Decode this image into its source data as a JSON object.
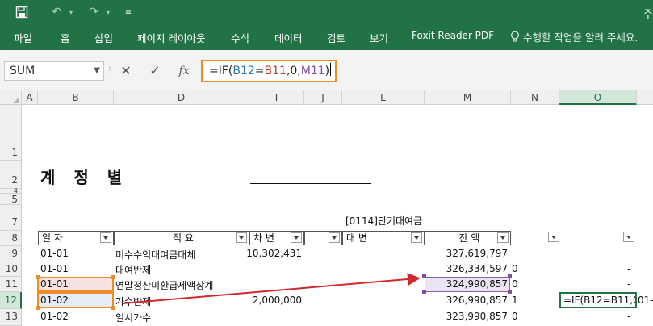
{
  "quick_access": {
    "save_icon": "save-icon",
    "undo_icon": "undo-icon",
    "redo_icon": "redo-icon",
    "customize_icon": "customize-icon"
  },
  "window": {
    "title_fragment": "주"
  },
  "ribbon": {
    "tabs": [
      "파일",
      "홈",
      "삽입",
      "페이지 레이아웃",
      "수식",
      "데이터",
      "검토",
      "보기",
      "Foxit Reader PDF"
    ],
    "tell_me": "수행할 작업을 알려 주세요."
  },
  "formula_bar": {
    "name_box": "SUM",
    "cancel_label": "✕",
    "enter_label": "✓",
    "fx_label": "fx",
    "formula_parts": [
      "=IF(",
      "B12",
      "=",
      "B11",
      ",0,",
      "M11",
      ")"
    ]
  },
  "columns": [
    "A",
    "B",
    "D",
    "I",
    "J",
    "L",
    "M",
    "N",
    "O"
  ],
  "rows": [
    "1",
    "2",
    "4",
    "5",
    "7",
    "8",
    "9",
    "10",
    "11",
    "12",
    "13"
  ],
  "sheet": {
    "title": "계 정 별",
    "subtitle": "[0114]단기대여금",
    "headers": {
      "date": "일  자",
      "desc": "적          요",
      "debit": "차  변",
      "credit": "대  변",
      "balance": "잔    액"
    },
    "data_rows": [
      {
        "date": "01-01",
        "desc": "미수수익대여금대체",
        "debit": "10,302,431",
        "balance": "327,619,797",
        "n": "",
        "o": ""
      },
      {
        "date": "01-01",
        "desc": "대여반제",
        "debit": "",
        "balance": "326,334,597",
        "n": "0",
        "o": "-"
      },
      {
        "date": "01-01",
        "desc": "연말정산미환급세액상계",
        "debit": "",
        "balance": "324,990,857",
        "n": "0",
        "o": "-"
      },
      {
        "date": "01-02",
        "desc": "가수반제",
        "debit": "2,000,000",
        "balance": "326,990,857",
        "n": "1",
        "o": "=IF(B12=B11,0"
      },
      {
        "date": "01-02",
        "desc": "일시가수",
        "debit": "",
        "balance": "323,990,857",
        "n": "0",
        "o": "-"
      }
    ],
    "overflow_text": "01-"
  },
  "colors": {
    "excel_green": "#217346",
    "orange": "#f08c28",
    "purple": "#7f4fa3",
    "blue": "#2e75b6",
    "arrow_red": "#d0282e"
  }
}
